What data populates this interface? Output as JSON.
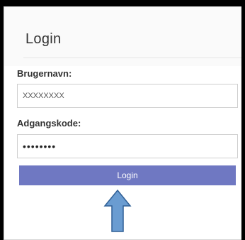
{
  "form": {
    "title": "Login",
    "username_label": "Brugernavn:",
    "username_value": "XXXXXXXX",
    "password_label": "Adgangskode:",
    "password_value": "••••••••",
    "submit_label": "Login"
  },
  "annotation": {
    "arrow_icon": "up-arrow-icon",
    "arrow_color": "#6a9cd1"
  },
  "colors": {
    "button": "#6f78c2",
    "button_text": "#ffffff",
    "frame": "#000000"
  }
}
